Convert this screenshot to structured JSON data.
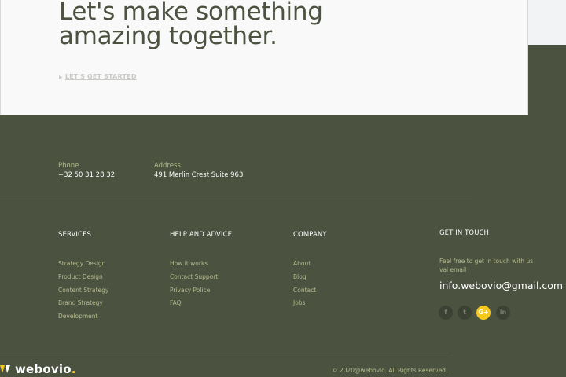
{
  "cta": {
    "title_line1": "Let's make something",
    "title_line2": "amazing together.",
    "link": "LET'S GET STARTED"
  },
  "contact": {
    "phone_label": "Phone",
    "phone_value": "+32 50 31 28 32",
    "address_label": "Address",
    "address_value": "491 Merlin Crest Suite 963"
  },
  "columns": {
    "services": {
      "title": "SERVICES",
      "links": [
        "Strategy Design",
        "Product Design",
        "Content Strategy",
        "Brand Strategy",
        "Development"
      ]
    },
    "help": {
      "title": "HELP AND ADVICE",
      "links": [
        "How it works",
        "Contact Support",
        "Privacy Police",
        "FAQ"
      ]
    },
    "company": {
      "title": "COMPANY",
      "links": [
        "About",
        "Blog",
        "Contact",
        "Jobs"
      ]
    },
    "get_in_touch": {
      "title": "GET IN TOUCH",
      "text": "Feel free to get in touch with us vai email",
      "email": "info.webovio@gmail.com"
    }
  },
  "social": {
    "icons": [
      "facebook-icon",
      "twitter-icon",
      "google-plus-icon",
      "linkedin-icon"
    ],
    "glyphs": [
      "f",
      "t",
      "G+",
      "in"
    ],
    "active_index": 2
  },
  "brand": {
    "name": "webovio",
    "dot": ".",
    "copyright": "© 2020@webovio. All Rights Reserved."
  },
  "colors": {
    "footer_bg": "#4b5240",
    "accent_yellow": "#f6c91f",
    "muted_text": "#b5ba8d",
    "cta_bg": "#f9f9fa"
  }
}
